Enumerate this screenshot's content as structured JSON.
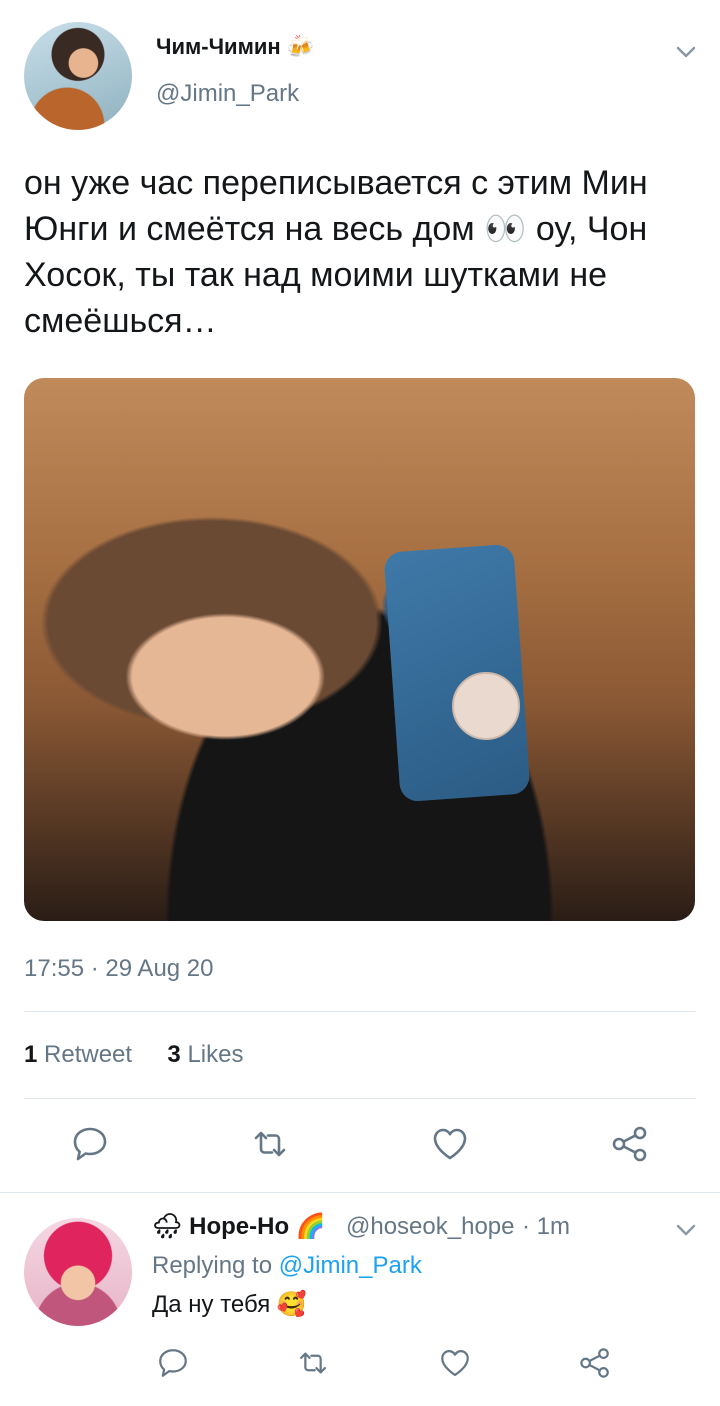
{
  "tweet": {
    "display_name": "Чим-Чимин",
    "name_emoji": "🍻",
    "handle": "@Jimin_Park",
    "text": "он уже час переписывается с этим Мин Юнги и смеётся на весь дом 👀 оу, Чон Хосок, ты так над моими шутками не смеёшься…",
    "time": "17:55",
    "separator": " · ",
    "date": "29 Aug 20",
    "retweet_count": "1",
    "retweet_label": "Retweet",
    "likes_count": "3",
    "likes_label": "Likes"
  },
  "reply": {
    "name_prefix_emoji": "🌧",
    "display_name": "Hope-Ho",
    "name_emoji": "🌈",
    "handle": "@hoseok_hope",
    "separator": " · ",
    "time": "1m",
    "replying_label": "Replying to",
    "replying_to": "@Jimin_Park",
    "text": "Да ну тебя",
    "text_emoji": "🥰"
  },
  "icons": {
    "chevron": "chevron-down-icon",
    "reply": "comment-icon",
    "retweet": "retweet-icon",
    "like": "heart-icon",
    "share": "share-icon"
  },
  "colors": {
    "text_primary": "#14171a",
    "text_secondary": "#657786",
    "link": "#1da1f2",
    "divider": "#e1e8ed",
    "icon": "#657786"
  }
}
